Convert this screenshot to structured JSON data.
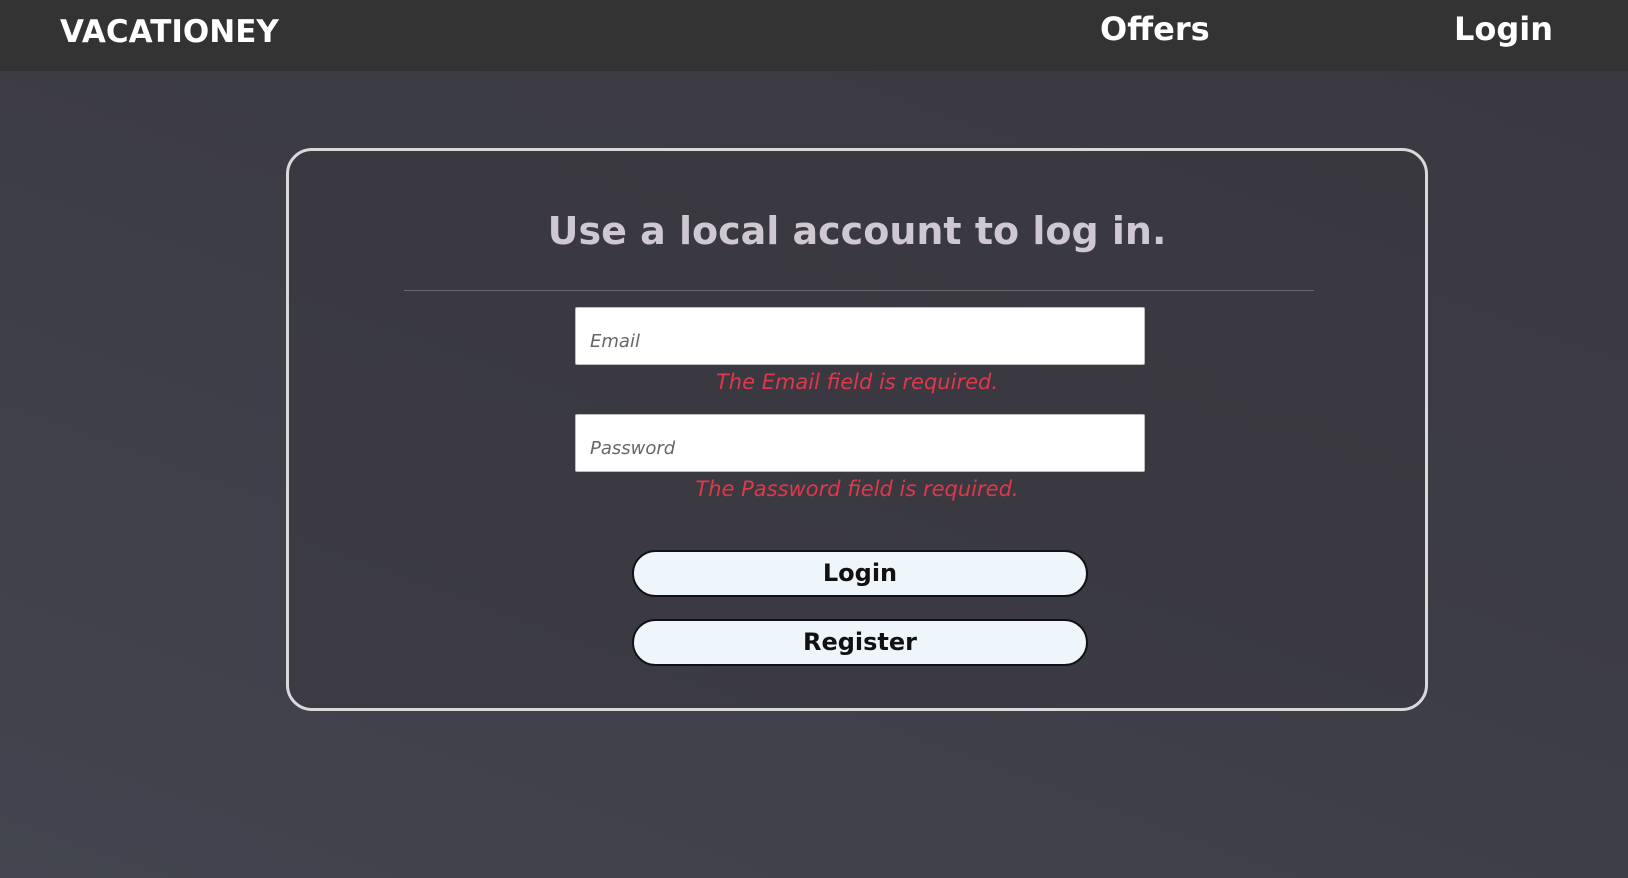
{
  "navbar": {
    "brand": "VACATIONEY",
    "links": {
      "offers": "Offers",
      "login": "Login"
    }
  },
  "login_form": {
    "title": "Use a local account to log in.",
    "email": {
      "placeholder": "Email",
      "value": "",
      "error": "The Email field is required."
    },
    "password": {
      "placeholder": "Password",
      "value": "",
      "error": "The Password field is required."
    },
    "login_button": "Login",
    "register_button": "Register"
  },
  "colors": {
    "navbar_bg": "#333333",
    "page_bg": "#3d3d46",
    "error": "#e0384a",
    "button_bg": "#eef6fc",
    "title": "#cfc8d0"
  }
}
